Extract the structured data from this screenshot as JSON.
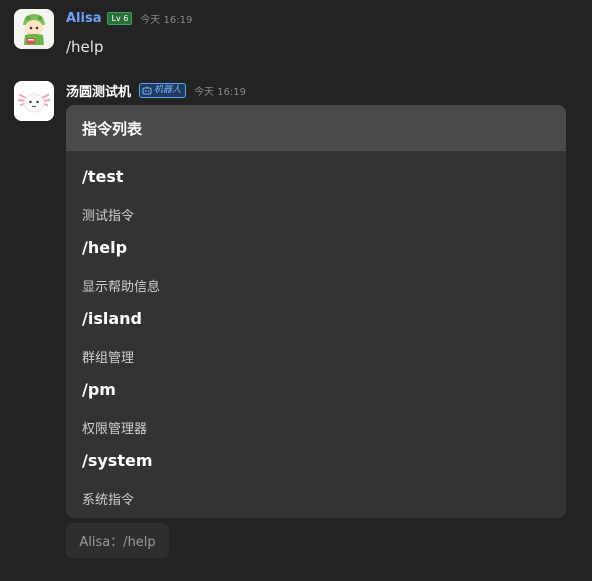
{
  "messages": [
    {
      "user": "Alisa",
      "level": "Lv 6",
      "time": "今天 16:19",
      "text": "/help"
    },
    {
      "user": "汤圆测试机",
      "badge": "机器人",
      "time": "今天 16:19"
    }
  ],
  "card": {
    "title": "指令列表",
    "commands": [
      {
        "name": "/test",
        "desc": "测试指令"
      },
      {
        "name": "/help",
        "desc": "显示帮助信息"
      },
      {
        "name": "/island",
        "desc": "群组管理"
      },
      {
        "name": "/pm",
        "desc": "权限管理器"
      },
      {
        "name": "/system",
        "desc": "系统指令"
      }
    ]
  },
  "reply": {
    "text": "Alisa：/help"
  },
  "colors": {
    "background": "#232323",
    "card": "#333333",
    "card_header": "#4a4a4a",
    "username_alisa": "#6fa1ff",
    "level_badge": "#2b6e3a",
    "bot_badge": "#1f3a5e"
  },
  "icons": {
    "alisa_avatar": "green-dinosaur-avatar-icon",
    "bot_avatar": "white-axolotl-avatar-icon",
    "bot_badge": "robot-icon"
  }
}
